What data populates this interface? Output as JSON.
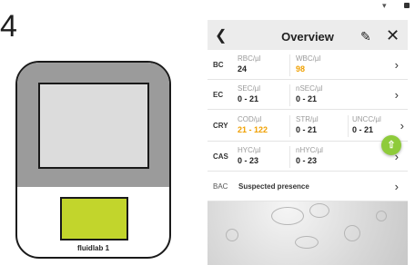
{
  "step": {
    "number": "4"
  },
  "device": {
    "brand": "fluidlab 1"
  },
  "status_bar": {
    "wifi_icon": "wifi-icon",
    "battery_icon": "battery-icon"
  },
  "header": {
    "title": "Overview",
    "back_icon": "chevron-left-icon",
    "edit_icon": "pencil-icon",
    "close_icon": "close-icon"
  },
  "rows": [
    {
      "code": "BC",
      "cells": [
        {
          "label": "RBC/µl",
          "value": "24",
          "status": "normal"
        },
        {
          "label": "WBC/µl",
          "value": "98",
          "status": "warn"
        }
      ]
    },
    {
      "code": "EC",
      "cells": [
        {
          "label": "SEC/µl",
          "value": "0 - 21",
          "status": "normal"
        },
        {
          "label": "nSEC/µl",
          "value": "0 - 21",
          "status": "normal"
        }
      ]
    },
    {
      "code": "CRY",
      "cells": [
        {
          "label": "COD/µl",
          "value": "21 - 122",
          "status": "warn"
        },
        {
          "label": "STR/µl",
          "value": "0 - 21",
          "status": "normal"
        },
        {
          "label": "UNCC/µl",
          "value": "0 - 21",
          "status": "normal"
        }
      ]
    },
    {
      "code": "CAS",
      "cells": [
        {
          "label": "HYC/µl",
          "value": "0 - 23",
          "status": "normal"
        },
        {
          "label": "nHYC/µl",
          "value": "0 - 23",
          "status": "normal"
        }
      ]
    },
    {
      "code": "BAC",
      "text": "Suspected presence"
    }
  ],
  "colors": {
    "accent_green": "#8ecb3b",
    "warn_orange": "#f0a000",
    "device_pad": "#c2d52c"
  },
  "fab": {
    "icon": "cloud-upload-icon"
  }
}
